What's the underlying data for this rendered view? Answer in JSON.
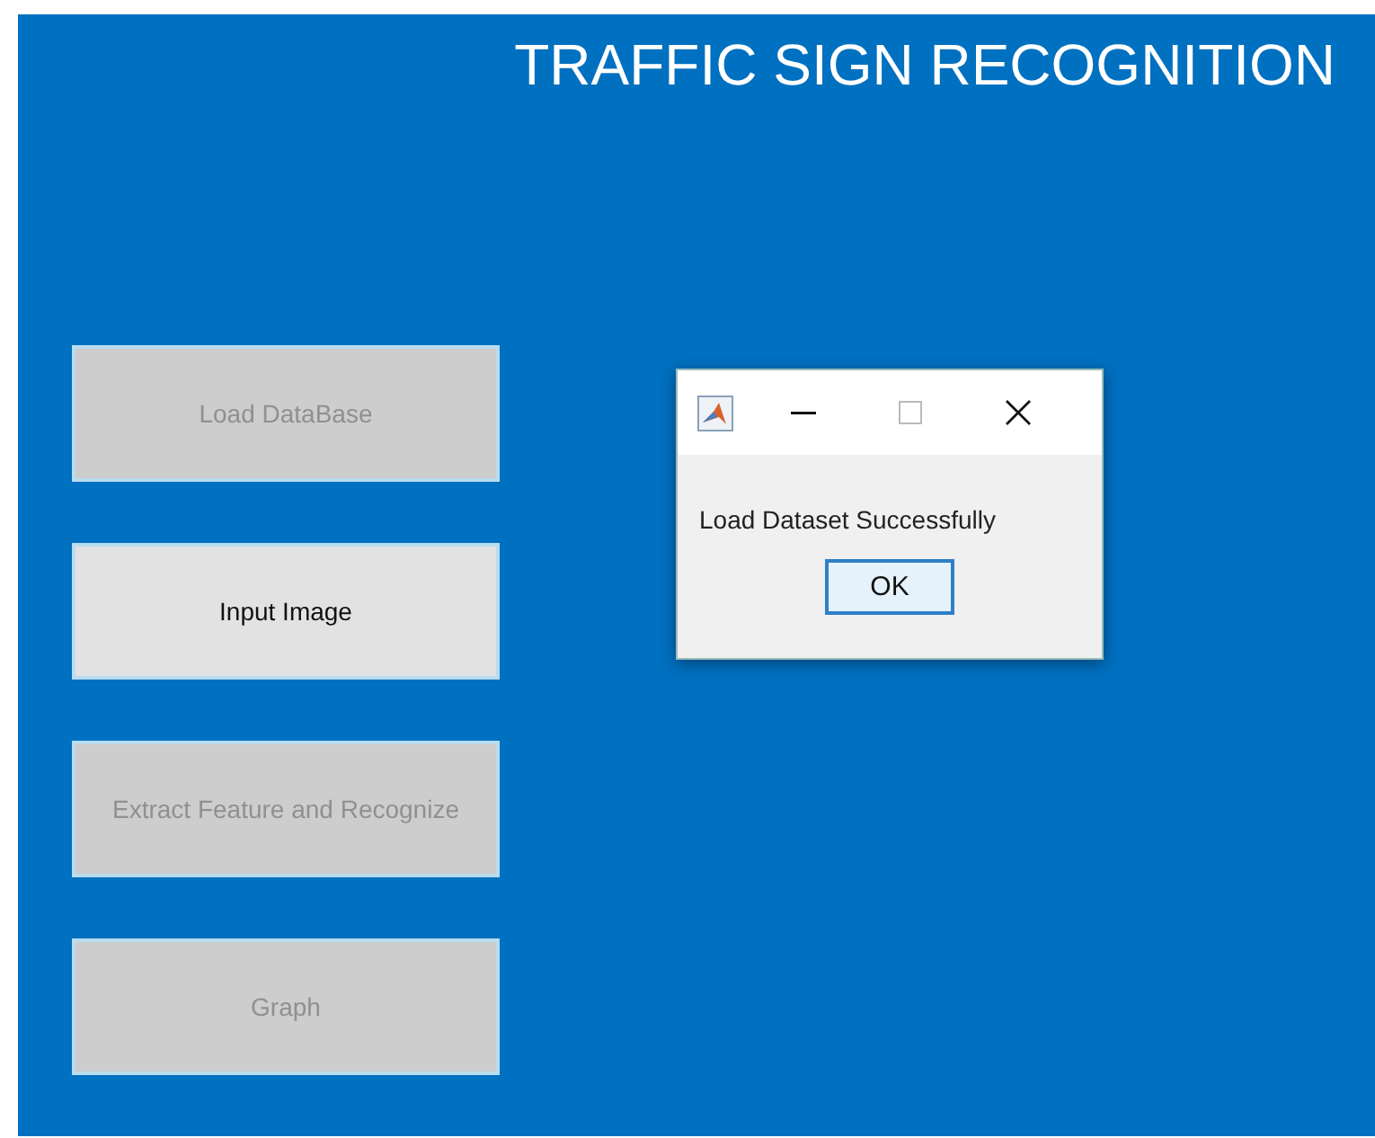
{
  "title": "TRAFFIC SIGN RECOGNITION",
  "buttons": [
    {
      "label": "Load DataBase",
      "disabled": true
    },
    {
      "label": "Input Image",
      "disabled": false
    },
    {
      "label": "Extract Feature and Recognize",
      "disabled": true
    },
    {
      "label": "Graph",
      "disabled": true
    }
  ],
  "dialog": {
    "message": "Load Dataset Successfully",
    "button": "OK"
  }
}
